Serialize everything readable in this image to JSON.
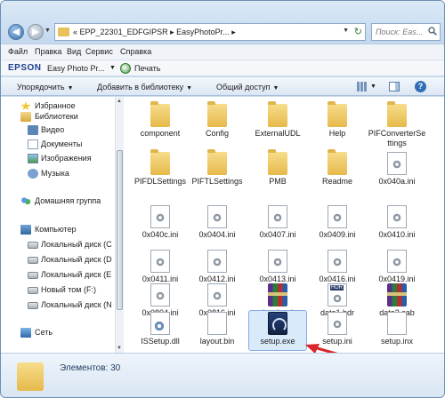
{
  "addressbar": {
    "path_prefix": "«",
    "crumbs": [
      "EPP_22301_EDFGIPSR",
      "EasyPhotoPr..."
    ],
    "separator": "▸"
  },
  "search": {
    "placeholder": "Поиск: Eas..."
  },
  "menubar": [
    "Файл",
    "Правка",
    "Вид",
    "Сервис",
    "Справка"
  ],
  "epson": {
    "logo": "EPSON",
    "app_label": "Easy Photo Pr...",
    "print_label": "Печать"
  },
  "commandbar": {
    "organize": "Упорядочить",
    "add_to_library": "Добавить в библиотеку",
    "share": "Общий доступ"
  },
  "navpane": {
    "favorites": "Избранное",
    "libraries": "Библиотеки",
    "video": "Видео",
    "documents": "Документы",
    "images": "Изображения",
    "music": "Музыка",
    "homegroup": "Домашняя группа",
    "computer": "Компьютер",
    "disk_c": "Локальный диск (C",
    "disk_d": "Локальный диск (D",
    "disk_e": "Локальный диск (E",
    "vol_f": "Новый том (F:)",
    "disk_n": "Локальный диск (N",
    "network": "Сеть"
  },
  "files": [
    {
      "name": "component",
      "type": "folder"
    },
    {
      "name": "Config",
      "type": "folder"
    },
    {
      "name": "ExternalUDL",
      "type": "folder"
    },
    {
      "name": "Help",
      "type": "folder"
    },
    {
      "name": "PIFConverterSettings",
      "type": "folder"
    },
    {
      "name": "PIFDLSettings",
      "type": "folder"
    },
    {
      "name": "PIFTLSettings",
      "type": "folder"
    },
    {
      "name": "PMB",
      "type": "folder"
    },
    {
      "name": "Readme",
      "type": "folder"
    },
    {
      "name": "0x040a.ini",
      "type": "ini"
    },
    {
      "name": "0x040c.ini",
      "type": "ini"
    },
    {
      "name": "0x0404.ini",
      "type": "ini"
    },
    {
      "name": "0x0407.ini",
      "type": "ini"
    },
    {
      "name": "0x0409.ini",
      "type": "ini"
    },
    {
      "name": "0x0410.ini",
      "type": "ini"
    },
    {
      "name": "0x0411.ini",
      "type": "ini"
    },
    {
      "name": "0x0412.ini",
      "type": "ini"
    },
    {
      "name": "0x0413.ini",
      "type": "ini"
    },
    {
      "name": "0x0416.ini",
      "type": "ini"
    },
    {
      "name": "0x0419.ini",
      "type": "ini"
    },
    {
      "name": "0x0804.ini",
      "type": "ini"
    },
    {
      "name": "0x0816.ini",
      "type": "ini"
    },
    {
      "name": "data1.cab",
      "type": "cab"
    },
    {
      "name": "data1.hdr",
      "type": "hdr"
    },
    {
      "name": "data2.cab",
      "type": "cab"
    },
    {
      "name": "ISSetup.dll",
      "type": "dll"
    },
    {
      "name": "layout.bin",
      "type": "bin"
    },
    {
      "name": "setup.exe",
      "type": "exe",
      "selected": true
    },
    {
      "name": "setup.ini",
      "type": "ini"
    },
    {
      "name": "setup.inx",
      "type": "bin"
    }
  ],
  "details": {
    "item_count": "Элементов: 30"
  },
  "colors": {
    "annotation_arrow": "#d9262b",
    "selection": "#d9ebfb"
  }
}
